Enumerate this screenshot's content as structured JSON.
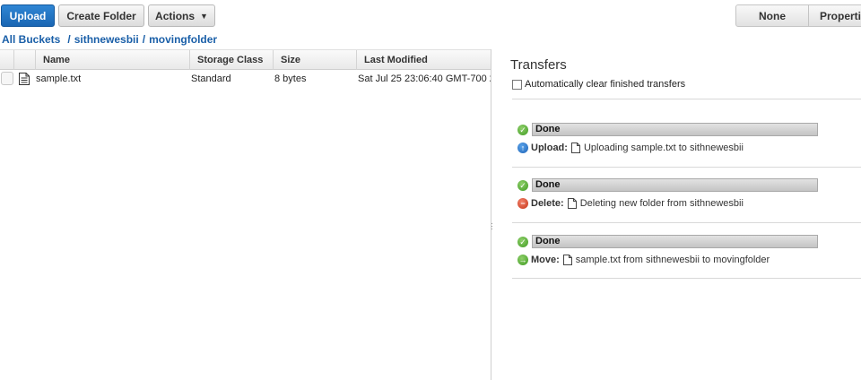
{
  "toolbar": {
    "upload_label": "Upload",
    "create_folder_label": "Create Folder",
    "actions_label": "Actions",
    "none_label": "None",
    "properties_label": "Properti"
  },
  "breadcrumb": {
    "all_buckets": "All Buckets",
    "bucket": "sithnewesbii",
    "folder": "movingfolder",
    "separator": "/"
  },
  "table": {
    "columns": [
      "Name",
      "Storage Class",
      "Size",
      "Last Modified"
    ],
    "rows": [
      {
        "name": "sample.txt",
        "storage_class": "Standard",
        "size": "8 bytes",
        "last_modified": "Sat Jul 25 23:06:40 GMT-700 20"
      }
    ]
  },
  "transfers": {
    "title": "Transfers",
    "auto_clear_label": "Automatically clear finished transfers",
    "items": [
      {
        "status": "Done",
        "op": "Upload:",
        "op_icon": "upload-arrow-icon",
        "description": "Uploading sample.txt to sithnewesbii"
      },
      {
        "status": "Done",
        "op": "Delete:",
        "op_icon": "delete-minus-icon",
        "description": "Deleting new folder from sithnewesbii"
      },
      {
        "status": "Done",
        "op": "Move:",
        "op_icon": "move-arrow-icon",
        "description": "sample.txt from sithnewesbii to movingfolder"
      }
    ]
  },
  "colors": {
    "accent_blue": "#1a66b3",
    "link_blue": "#1a5fa8",
    "done_green": "#3f9a22",
    "delete_red": "#c53317"
  }
}
